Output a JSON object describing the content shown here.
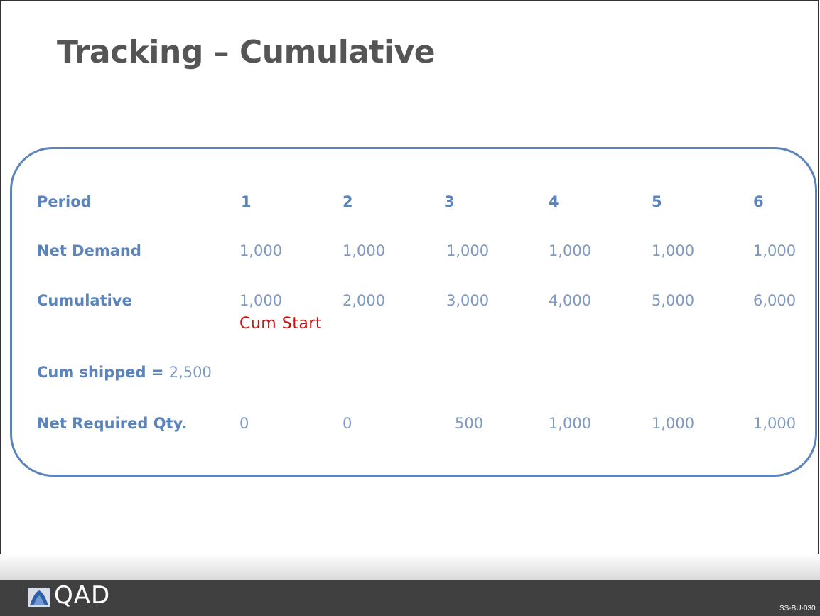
{
  "slide": {
    "title": "Tracking – Cumulative",
    "code": "SS-BU-030"
  },
  "table": {
    "rows": [
      {
        "label": "Period",
        "values": [
          "1",
          "2",
          "3",
          "4",
          "5",
          "6"
        ]
      },
      {
        "label": "Net Demand",
        "values": [
          "1,000",
          "1,000",
          "1,000",
          "1,000",
          "1,000",
          "1,000"
        ]
      },
      {
        "label": "Cumulative",
        "values": [
          "1,000",
          "2,000",
          "3,000",
          "4,000",
          "5,000",
          "6,000"
        ]
      },
      {
        "label": "Net Required Qty.",
        "values": [
          "0",
          "0",
          "500",
          "1,000",
          "1,000",
          "1,000"
        ]
      }
    ],
    "cum_start_note": "Cum Start",
    "cum_shipped_label": "Cum shipped",
    "cum_shipped_equals": " = ",
    "cum_shipped_value": "2,500"
  },
  "footer": {
    "logo_text": "QAD"
  },
  "colors": {
    "accent": "#5b84bd",
    "value_text": "#7e99c2",
    "highlight": "#cc1111",
    "footer_bg": "#404040"
  }
}
